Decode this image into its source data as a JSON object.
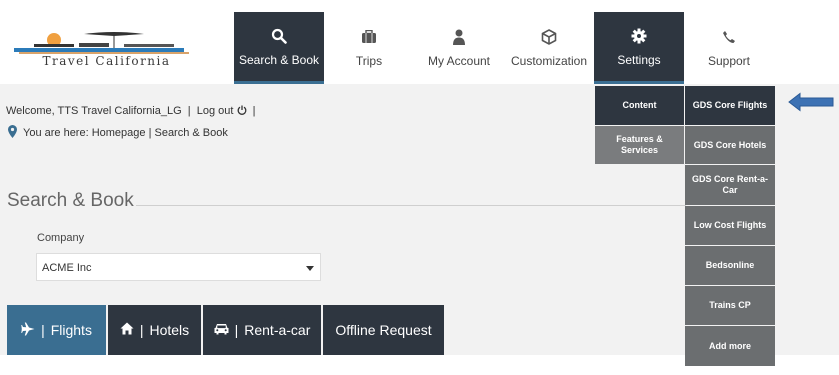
{
  "brand": {
    "logo_text": "Travel California"
  },
  "nav": [
    {
      "label": "Search & Book",
      "icon": "search-icon"
    },
    {
      "label": "Trips",
      "icon": "briefcase-icon"
    },
    {
      "label": "My Account",
      "icon": "user-icon"
    },
    {
      "label": "Customization",
      "icon": "cube-icon"
    },
    {
      "label": "Settings",
      "icon": "gear-icon"
    },
    {
      "label": "Support",
      "icon": "phone-icon"
    }
  ],
  "welcome": {
    "text": "Welcome, TTS Travel California_LG",
    "sep1": "|",
    "logout": "Log out",
    "sep2": "|"
  },
  "breadcrumb": {
    "text": "You are here: Homepage | Search & Book"
  },
  "search_book": {
    "title": "Search & Book"
  },
  "company": {
    "label": "Company",
    "value": "ACME Inc"
  },
  "tabs": [
    {
      "label": "Flights",
      "icon": "plane-icon"
    },
    {
      "label": "Hotels",
      "icon": "home-icon"
    },
    {
      "label": "Rent-a-car",
      "icon": "car-icon"
    },
    {
      "label": "Offline Request"
    }
  ],
  "tab_separator": "|",
  "settings_menu": {
    "col1": [
      "Content",
      "Features & Services"
    ],
    "col2": [
      "GDS Core Flights",
      "GDS Core Hotels",
      "GDS Core Rent-a-Car",
      "Low Cost Flights",
      "Bedsonline",
      "Trains CP",
      "Add more"
    ]
  },
  "colors": {
    "dark": "#2e3640",
    "accent": "#3a6e91",
    "grey": "#6b6e70",
    "arrow": "#3d72b4"
  }
}
